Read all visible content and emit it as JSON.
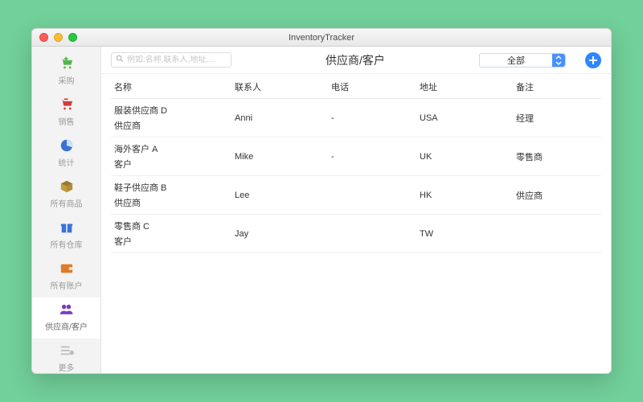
{
  "window": {
    "title": "InventoryTracker"
  },
  "sidebar": {
    "items": [
      {
        "label": "采购"
      },
      {
        "label": "销售"
      },
      {
        "label": "统计"
      },
      {
        "label": "所有商品"
      },
      {
        "label": "所有仓库"
      },
      {
        "label": "所有账户"
      },
      {
        "label": "供应商/客户"
      }
    ],
    "more_label": "更多"
  },
  "toolbar": {
    "search_placeholder": "例如:名称,联系人,地址,...",
    "heading": "供应商/客户",
    "filter_selected": "全部"
  },
  "columns": {
    "name": "名称",
    "contact": "联系人",
    "phone": "电话",
    "address": "地址",
    "note": "备注"
  },
  "rows": [
    {
      "name": "服装供应商 D",
      "type": "供应商",
      "contact": "Anni",
      "phone": "-",
      "address": "USA",
      "note": "经理"
    },
    {
      "name": "海外客户 A",
      "type": "客户",
      "contact": "Mike",
      "phone": "-",
      "address": "UK",
      "note": "零售商"
    },
    {
      "name": "鞋子供应商 B",
      "type": "供应商",
      "contact": "Lee",
      "phone": "",
      "address": "HK",
      "note": "供应商"
    },
    {
      "name": "零售商 C",
      "type": "客户",
      "contact": "Jay",
      "phone": "",
      "address": "TW",
      "note": ""
    }
  ]
}
